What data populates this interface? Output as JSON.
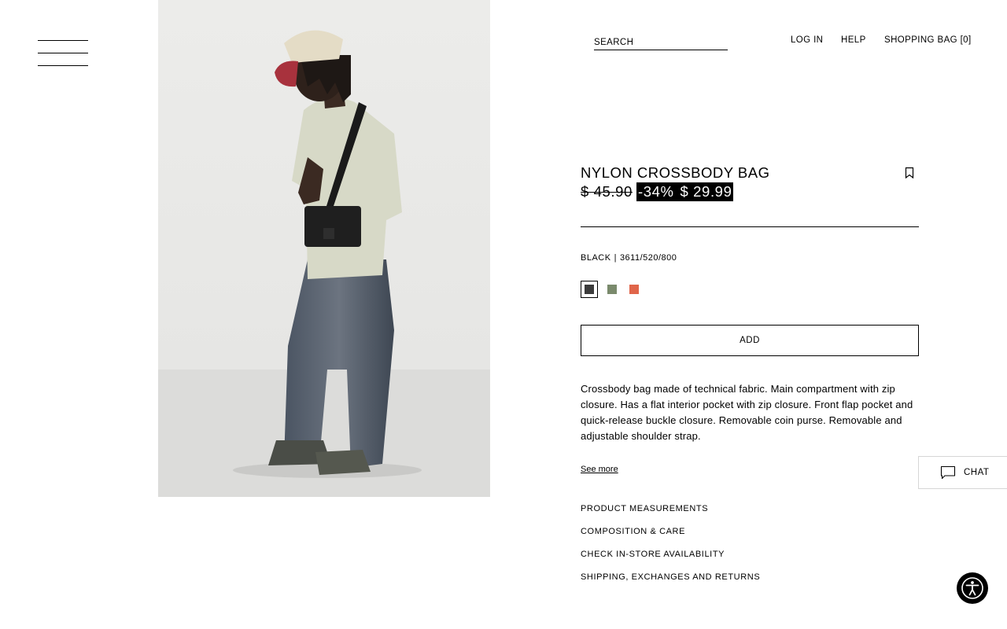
{
  "header": {
    "search_placeholder": "SEARCH",
    "login": "LOG IN",
    "help": "HELP",
    "bag": "SHOPPING BAG [0]"
  },
  "product": {
    "title": "NYLON CROSSBODY BAG",
    "price_original": "$ 45.90",
    "discount": "-34%",
    "price_sale": "$ 29.99",
    "color_name": "BLACK",
    "color_separator": "|",
    "reference": "3611/520/800",
    "swatches": [
      {
        "color": "#3b3b3b",
        "selected": true
      },
      {
        "color": "#7a8a6c",
        "selected": false
      },
      {
        "color": "#e0654a",
        "selected": false
      }
    ],
    "add_label": "ADD",
    "description": "Crossbody bag made of technical fabric. Main compartment with zip closure. Has a flat interior pocket with zip closure. Front flap pocket and quick-release buckle closure. Removable coin purse. Removable and adjustable shoulder strap.",
    "see_more": "See more",
    "sections": [
      "PRODUCT MEASUREMENTS",
      "COMPOSITION & CARE",
      "CHECK IN-STORE AVAILABILITY",
      "SHIPPING, EXCHANGES AND RETURNS"
    ]
  },
  "chat": {
    "label": "CHAT"
  },
  "icons": {
    "menu": "hamburger-menu-icon",
    "bookmark": "bookmark-icon",
    "chat": "chat-bubble-icon",
    "accessibility": "accessibility-icon"
  }
}
